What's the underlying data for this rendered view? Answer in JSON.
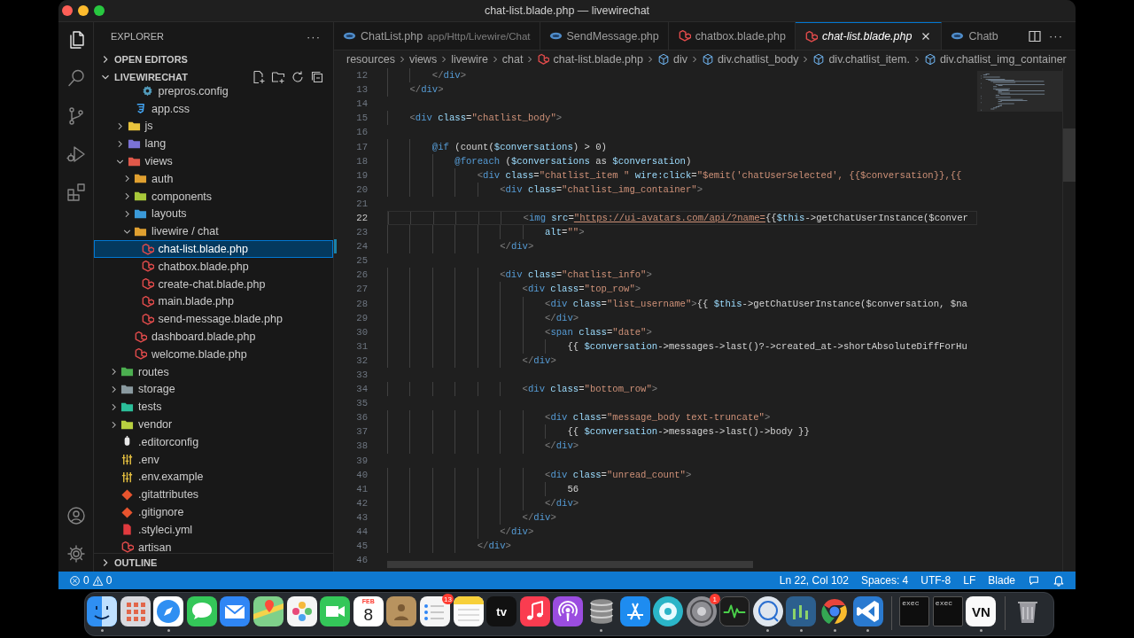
{
  "window": {
    "title": "chat-list.blade.php — livewirechat"
  },
  "activity_bar": [
    {
      "kind": "files",
      "selected": true
    },
    {
      "kind": "search",
      "selected": false
    },
    {
      "kind": "branch",
      "selected": false
    },
    {
      "kind": "debug",
      "selected": false
    },
    {
      "kind": "extensions",
      "selected": false
    }
  ],
  "activity_bar_bottom": [
    {
      "kind": "account",
      "selected": false
    },
    {
      "kind": "gear",
      "selected": false
    }
  ],
  "explorer": {
    "title": "EXPLORER",
    "more": "···",
    "sections": [
      {
        "label": "OPEN EDITORS",
        "expanded": false
      },
      {
        "label": "LIVEWIRECHAT",
        "expanded": true
      },
      {
        "label": "OUTLINE",
        "expanded": false
      }
    ],
    "tree": [
      {
        "children": [
          {
            "children": [
              {
                "children": [
                  {
                    "label": "prepros.config",
                    "kind": "gear",
                    "selected": false
                  }
                ]
              },
              {
                "label": "app.css",
                "kind": "css",
                "selected": false
              }
            ]
          },
          {
            "label": "js",
            "kind": "folder",
            "color": "#e8c33c",
            "expanded": false,
            "selected": false
          },
          {
            "label": "lang",
            "kind": "folder",
            "color": "#7b72d6",
            "expanded": false,
            "selected": false
          },
          {
            "label": "views",
            "kind": "folder",
            "color": "#e0584a",
            "expanded": true,
            "selected": false,
            "children": [
              {
                "label": "auth",
                "kind": "folder",
                "color": "#e0a030",
                "expanded": false,
                "selected": false
              },
              {
                "label": "components",
                "kind": "folder",
                "color": "#a8c83a",
                "expanded": false,
                "selected": false
              },
              {
                "label": "layouts",
                "kind": "folder",
                "color": "#3b9ad9",
                "expanded": false,
                "selected": false
              },
              {
                "label": "livewire / chat",
                "kind": "folder",
                "color": "#e0a030",
                "expanded": true,
                "selected": false,
                "children": [
                  {
                    "label": "chat-list.blade.php",
                    "kind": "blade",
                    "selected": true
                  },
                  {
                    "label": "chatbox.blade.php",
                    "kind": "blade",
                    "selected": false
                  },
                  {
                    "label": "create-chat.blade.php",
                    "kind": "blade",
                    "selected": false
                  },
                  {
                    "label": "main.blade.php",
                    "kind": "blade",
                    "selected": false
                  },
                  {
                    "label": "send-message.blade.php",
                    "kind": "blade",
                    "selected": false
                  }
                ]
              },
              {
                "label": "dashboard.blade.php",
                "kind": "blade",
                "selected": false
              },
              {
                "label": "welcome.blade.php",
                "kind": "blade",
                "selected": false
              }
            ]
          }
        ]
      },
      {
        "label": "routes",
        "kind": "folder",
        "color": "#4caf50",
        "expanded": false,
        "selected": false
      },
      {
        "label": "storage",
        "kind": "folder",
        "color": "#8a9aa0",
        "expanded": false,
        "selected": false
      },
      {
        "label": "tests",
        "kind": "folder",
        "color": "#2bbf9a",
        "expanded": false,
        "selected": false
      },
      {
        "label": "vendor",
        "kind": "folder",
        "color": "#b8d040",
        "expanded": false,
        "selected": false
      },
      {
        "label": ".editorconfig",
        "kind": "mouse",
        "selected": false
      },
      {
        "label": ".env",
        "kind": "env",
        "selected": false
      },
      {
        "label": ".env.example",
        "kind": "env",
        "selected": false
      },
      {
        "label": ".gitattributes",
        "kind": "git",
        "selected": false
      },
      {
        "label": ".gitignore",
        "kind": "git",
        "selected": false
      },
      {
        "label": ".styleci.yml",
        "kind": "yml",
        "selected": false
      },
      {
        "label": "artisan",
        "kind": "blade",
        "selected": false
      }
    ]
  },
  "tabs": [
    {
      "label": "ChatList.php",
      "description": "app/Http/Livewire/Chat",
      "kind": "php",
      "selected": false,
      "preview": false
    },
    {
      "label": "SendMessage.php",
      "kind": "php",
      "selected": false,
      "preview": false
    },
    {
      "label": "chatbox.blade.php",
      "kind": "blade",
      "selected": false,
      "preview": false
    },
    {
      "label": "chat-list.blade.php",
      "kind": "blade",
      "selected": true,
      "preview": true
    },
    {
      "label": "Chatb",
      "kind": "php",
      "selected": false,
      "preview": false
    }
  ],
  "tab_actions": {
    "more": "···"
  },
  "breadcrumb": [
    {
      "label": "resources",
      "kind": "folder"
    },
    {
      "label": "views",
      "kind": "folder"
    },
    {
      "label": "livewire",
      "kind": "folder"
    },
    {
      "label": "chat",
      "kind": "folder"
    },
    {
      "label": "chat-list.blade.php",
      "kind": "file"
    },
    {
      "label": "div",
      "kind": "symbol"
    },
    {
      "label": "div.chatlist_body",
      "kind": "symbol"
    },
    {
      "label": "div.chatlist_item.",
      "kind": "symbol"
    },
    {
      "label": "div.chatlist_img_container",
      "kind": "symbol"
    }
  ],
  "editor": {
    "lines": [
      {
        "n": "12",
        "current": false,
        "modified": false,
        "code": [
          {
            "kind": "p",
            "text": "        </"
          },
          {
            "kind": "tag",
            "text": "div"
          },
          {
            "kind": "p",
            "text": ">"
          }
        ]
      },
      {
        "n": "13",
        "current": false,
        "modified": false,
        "code": [
          {
            "kind": "p",
            "text": "    </"
          },
          {
            "kind": "tag",
            "text": "div"
          },
          {
            "kind": "p",
            "text": ">"
          }
        ]
      },
      {
        "n": "14",
        "current": false,
        "modified": false
      },
      {
        "n": "15",
        "current": false,
        "modified": false,
        "code": [
          {
            "kind": "p",
            "text": "    <"
          },
          {
            "kind": "tag",
            "text": "div"
          },
          {
            "kind": "attr",
            "text": " class"
          },
          {
            "kind": "t",
            "text": "="
          },
          {
            "kind": "str",
            "text": "\"chatlist_body\""
          },
          {
            "kind": "p",
            "text": ">"
          }
        ]
      },
      {
        "n": "16",
        "current": false,
        "modified": false
      },
      {
        "n": "17",
        "current": false,
        "modified": false,
        "code": [
          {
            "kind": "kw",
            "text": "        @if"
          },
          {
            "kind": "t",
            "text": " (count("
          },
          {
            "kind": "var",
            "text": "$conversations"
          },
          {
            "kind": "t",
            "text": ") > 0)"
          }
        ]
      },
      {
        "n": "18",
        "current": false,
        "modified": false,
        "code": [
          {
            "kind": "kw",
            "text": "            @foreach"
          },
          {
            "kind": "t",
            "text": " ("
          },
          {
            "kind": "var",
            "text": "$conversations"
          },
          {
            "kind": "t",
            "text": " as "
          },
          {
            "kind": "var",
            "text": "$conversation"
          },
          {
            "kind": "t",
            "text": ")"
          }
        ]
      },
      {
        "n": "19",
        "current": false,
        "modified": false,
        "code": [
          {
            "kind": "p",
            "text": "                <"
          },
          {
            "kind": "tag",
            "text": "div"
          },
          {
            "kind": "attr",
            "text": " class"
          },
          {
            "kind": "t",
            "text": "="
          },
          {
            "kind": "str",
            "text": "\"chatlist_item \""
          },
          {
            "kind": "attr",
            "text": " wire:click"
          },
          {
            "kind": "t",
            "text": "="
          },
          {
            "kind": "str",
            "text": "\"$emit('chatUserSelected', {{$conversation}},{{"
          }
        ]
      },
      {
        "n": "20",
        "current": false,
        "modified": false,
        "code": [
          {
            "kind": "p",
            "text": "                    <"
          },
          {
            "kind": "tag",
            "text": "div"
          },
          {
            "kind": "attr",
            "text": " class"
          },
          {
            "kind": "t",
            "text": "="
          },
          {
            "kind": "str",
            "text": "\"chatlist_img_container\""
          },
          {
            "kind": "p",
            "text": ">"
          }
        ]
      },
      {
        "n": "21",
        "current": false,
        "modified": false
      },
      {
        "n": "22",
        "current": true,
        "modified": false,
        "code": [
          {
            "kind": "p",
            "text": "                        <"
          },
          {
            "kind": "tag",
            "text": "img"
          },
          {
            "kind": "attr",
            "text": " src"
          },
          {
            "kind": "t",
            "text": "="
          },
          {
            "kind": "url",
            "text": "\"https://ui-avatars.com/api/?name="
          },
          {
            "kind": "t",
            "text": "{{"
          },
          {
            "kind": "var",
            "text": "$this"
          },
          {
            "kind": "t",
            "text": "->getChatUserInstance($conver"
          }
        ]
      },
      {
        "n": "23",
        "current": false,
        "modified": false,
        "code": [
          {
            "kind": "attr",
            "text": "                            alt"
          },
          {
            "kind": "t",
            "text": "="
          },
          {
            "kind": "str",
            "text": "\"\""
          },
          {
            "kind": "p",
            "text": ">"
          }
        ]
      },
      {
        "n": "24",
        "current": false,
        "modified": true,
        "code": [
          {
            "kind": "p",
            "text": "                    </"
          },
          {
            "kind": "tag",
            "text": "div"
          },
          {
            "kind": "p",
            "text": ">"
          }
        ]
      },
      {
        "n": "25",
        "current": false,
        "modified": false
      },
      {
        "n": "26",
        "current": false,
        "modified": false,
        "code": [
          {
            "kind": "p",
            "text": "                    <"
          },
          {
            "kind": "tag",
            "text": "div"
          },
          {
            "kind": "attr",
            "text": " class"
          },
          {
            "kind": "t",
            "text": "="
          },
          {
            "kind": "str",
            "text": "\"chatlist_info\""
          },
          {
            "kind": "p",
            "text": ">"
          }
        ]
      },
      {
        "n": "27",
        "current": false,
        "modified": false,
        "code": [
          {
            "kind": "p",
            "text": "                        <"
          },
          {
            "kind": "tag",
            "text": "div"
          },
          {
            "kind": "attr",
            "text": " class"
          },
          {
            "kind": "t",
            "text": "="
          },
          {
            "kind": "str",
            "text": "\"top_row\""
          },
          {
            "kind": "p",
            "text": ">"
          }
        ]
      },
      {
        "n": "28",
        "current": false,
        "modified": false,
        "code": [
          {
            "kind": "p",
            "text": "                            <"
          },
          {
            "kind": "tag",
            "text": "div"
          },
          {
            "kind": "attr",
            "text": " class"
          },
          {
            "kind": "t",
            "text": "="
          },
          {
            "kind": "str",
            "text": "\"list_username\""
          },
          {
            "kind": "p",
            "text": ">"
          },
          {
            "kind": "t",
            "text": "{{ "
          },
          {
            "kind": "var",
            "text": "$this"
          },
          {
            "kind": "t",
            "text": "->getChatUserInstance($conversation, $na"
          }
        ]
      },
      {
        "n": "29",
        "current": false,
        "modified": false,
        "code": [
          {
            "kind": "p",
            "text": "                            </"
          },
          {
            "kind": "tag",
            "text": "div"
          },
          {
            "kind": "p",
            "text": ">"
          }
        ]
      },
      {
        "n": "30",
        "current": false,
        "modified": false,
        "code": [
          {
            "kind": "p",
            "text": "                            <"
          },
          {
            "kind": "tag",
            "text": "span"
          },
          {
            "kind": "attr",
            "text": " class"
          },
          {
            "kind": "t",
            "text": "="
          },
          {
            "kind": "str",
            "text": "\"date\""
          },
          {
            "kind": "p",
            "text": ">"
          }
        ]
      },
      {
        "n": "31",
        "current": false,
        "modified": false,
        "code": [
          {
            "kind": "t",
            "text": "                                {{ "
          },
          {
            "kind": "var",
            "text": "$conversation"
          },
          {
            "kind": "t",
            "text": "->messages->last()?->created_at->shortAbsoluteDiffForHu"
          }
        ]
      },
      {
        "n": "32",
        "current": false,
        "modified": false,
        "code": [
          {
            "kind": "p",
            "text": "                        </"
          },
          {
            "kind": "tag",
            "text": "div"
          },
          {
            "kind": "p",
            "text": ">"
          }
        ]
      },
      {
        "n": "33",
        "current": false,
        "modified": false
      },
      {
        "n": "34",
        "current": false,
        "modified": false,
        "code": [
          {
            "kind": "p",
            "text": "                        <"
          },
          {
            "kind": "tag",
            "text": "div"
          },
          {
            "kind": "attr",
            "text": " class"
          },
          {
            "kind": "t",
            "text": "="
          },
          {
            "kind": "str",
            "text": "\"bottom_row\""
          },
          {
            "kind": "p",
            "text": ">"
          }
        ]
      },
      {
        "n": "35",
        "current": false,
        "modified": false
      },
      {
        "n": "36",
        "current": false,
        "modified": false,
        "code": [
          {
            "kind": "p",
            "text": "                            <"
          },
          {
            "kind": "tag",
            "text": "div"
          },
          {
            "kind": "attr",
            "text": " class"
          },
          {
            "kind": "t",
            "text": "="
          },
          {
            "kind": "str",
            "text": "\"message_body text-truncate\""
          },
          {
            "kind": "p",
            "text": ">"
          }
        ]
      },
      {
        "n": "37",
        "current": false,
        "modified": false,
        "code": [
          {
            "kind": "t",
            "text": "                                {{ "
          },
          {
            "kind": "var",
            "text": "$conversation"
          },
          {
            "kind": "t",
            "text": "->messages->last()->body }}"
          }
        ]
      },
      {
        "n": "38",
        "current": false,
        "modified": false,
        "code": [
          {
            "kind": "p",
            "text": "                            </"
          },
          {
            "kind": "tag",
            "text": "div"
          },
          {
            "kind": "p",
            "text": ">"
          }
        ]
      },
      {
        "n": "39",
        "current": false,
        "modified": false
      },
      {
        "n": "40",
        "current": false,
        "modified": false,
        "code": [
          {
            "kind": "p",
            "text": "                            <"
          },
          {
            "kind": "tag",
            "text": "div"
          },
          {
            "kind": "attr",
            "text": " class"
          },
          {
            "kind": "t",
            "text": "="
          },
          {
            "kind": "str",
            "text": "\"unread_count\""
          },
          {
            "kind": "p",
            "text": ">"
          }
        ]
      },
      {
        "n": "41",
        "current": false,
        "modified": false,
        "code": [
          {
            "kind": "t",
            "text": "                                56"
          }
        ]
      },
      {
        "n": "42",
        "current": false,
        "modified": false,
        "code": [
          {
            "kind": "p",
            "text": "                            </"
          },
          {
            "kind": "tag",
            "text": "div"
          },
          {
            "kind": "p",
            "text": ">"
          }
        ]
      },
      {
        "n": "43",
        "current": false,
        "modified": false,
        "code": [
          {
            "kind": "p",
            "text": "                        </"
          },
          {
            "kind": "tag",
            "text": "div"
          },
          {
            "kind": "p",
            "text": ">"
          }
        ]
      },
      {
        "n": "44",
        "current": false,
        "modified": false,
        "code": [
          {
            "kind": "p",
            "text": "                    </"
          },
          {
            "kind": "tag",
            "text": "div"
          },
          {
            "kind": "p",
            "text": ">"
          }
        ]
      },
      {
        "n": "45",
        "current": false,
        "modified": false,
        "code": [
          {
            "kind": "p",
            "text": "                </"
          },
          {
            "kind": "tag",
            "text": "div"
          },
          {
            "kind": "p",
            "text": ">"
          }
        ]
      },
      {
        "n": "46",
        "current": false,
        "modified": false
      }
    ]
  },
  "status_bar": {
    "errors": "0",
    "warnings": "0",
    "right": [
      "Ln 22, Col 102",
      "Spaces: 4",
      "UTF-8",
      "LF",
      "Blade"
    ]
  },
  "dock": {
    "apps": [
      {
        "kind": "face",
        "running": true
      },
      {
        "kind": "grid",
        "running": false
      },
      {
        "kind": "compass",
        "running": true
      },
      {
        "kind": "bubble",
        "running": false
      },
      {
        "kind": "envelope",
        "running": false
      },
      {
        "kind": "map",
        "running": false
      },
      {
        "kind": "flower",
        "running": false
      },
      {
        "kind": "camera",
        "running": false
      },
      {
        "kind": "calendar",
        "running": false,
        "month": "FEB",
        "day": "8"
      },
      {
        "kind": "contact",
        "running": false
      },
      {
        "kind": "list",
        "running": false,
        "badge": "13"
      },
      {
        "kind": "notepad",
        "running": false
      },
      {
        "kind": "tv",
        "running": false,
        "text": "tv"
      },
      {
        "kind": "note",
        "running": false
      },
      {
        "kind": "podcast",
        "running": false
      },
      {
        "kind": "database",
        "running": true
      },
      {
        "kind": "pencil",
        "running": false
      },
      {
        "kind": "tealgear",
        "running": false
      },
      {
        "kind": "gear",
        "running": false,
        "badge": "1"
      },
      {
        "kind": "waveform",
        "running": false
      },
      {
        "kind": "ring",
        "running": true
      },
      {
        "kind": "chart",
        "running": true
      },
      {
        "kind": "browser",
        "running": true
      },
      {
        "kind": "code",
        "running": true
      }
    ],
    "windows": [
      {
        "kind": "terminal",
        "running": false,
        "text": "exec"
      },
      {
        "kind": "terminal",
        "running": false,
        "text": "exec"
      },
      {
        "kind": "letters",
        "running": true,
        "text": "VN"
      }
    ],
    "trash": {
      "kind": "trash",
      "running": false
    }
  }
}
